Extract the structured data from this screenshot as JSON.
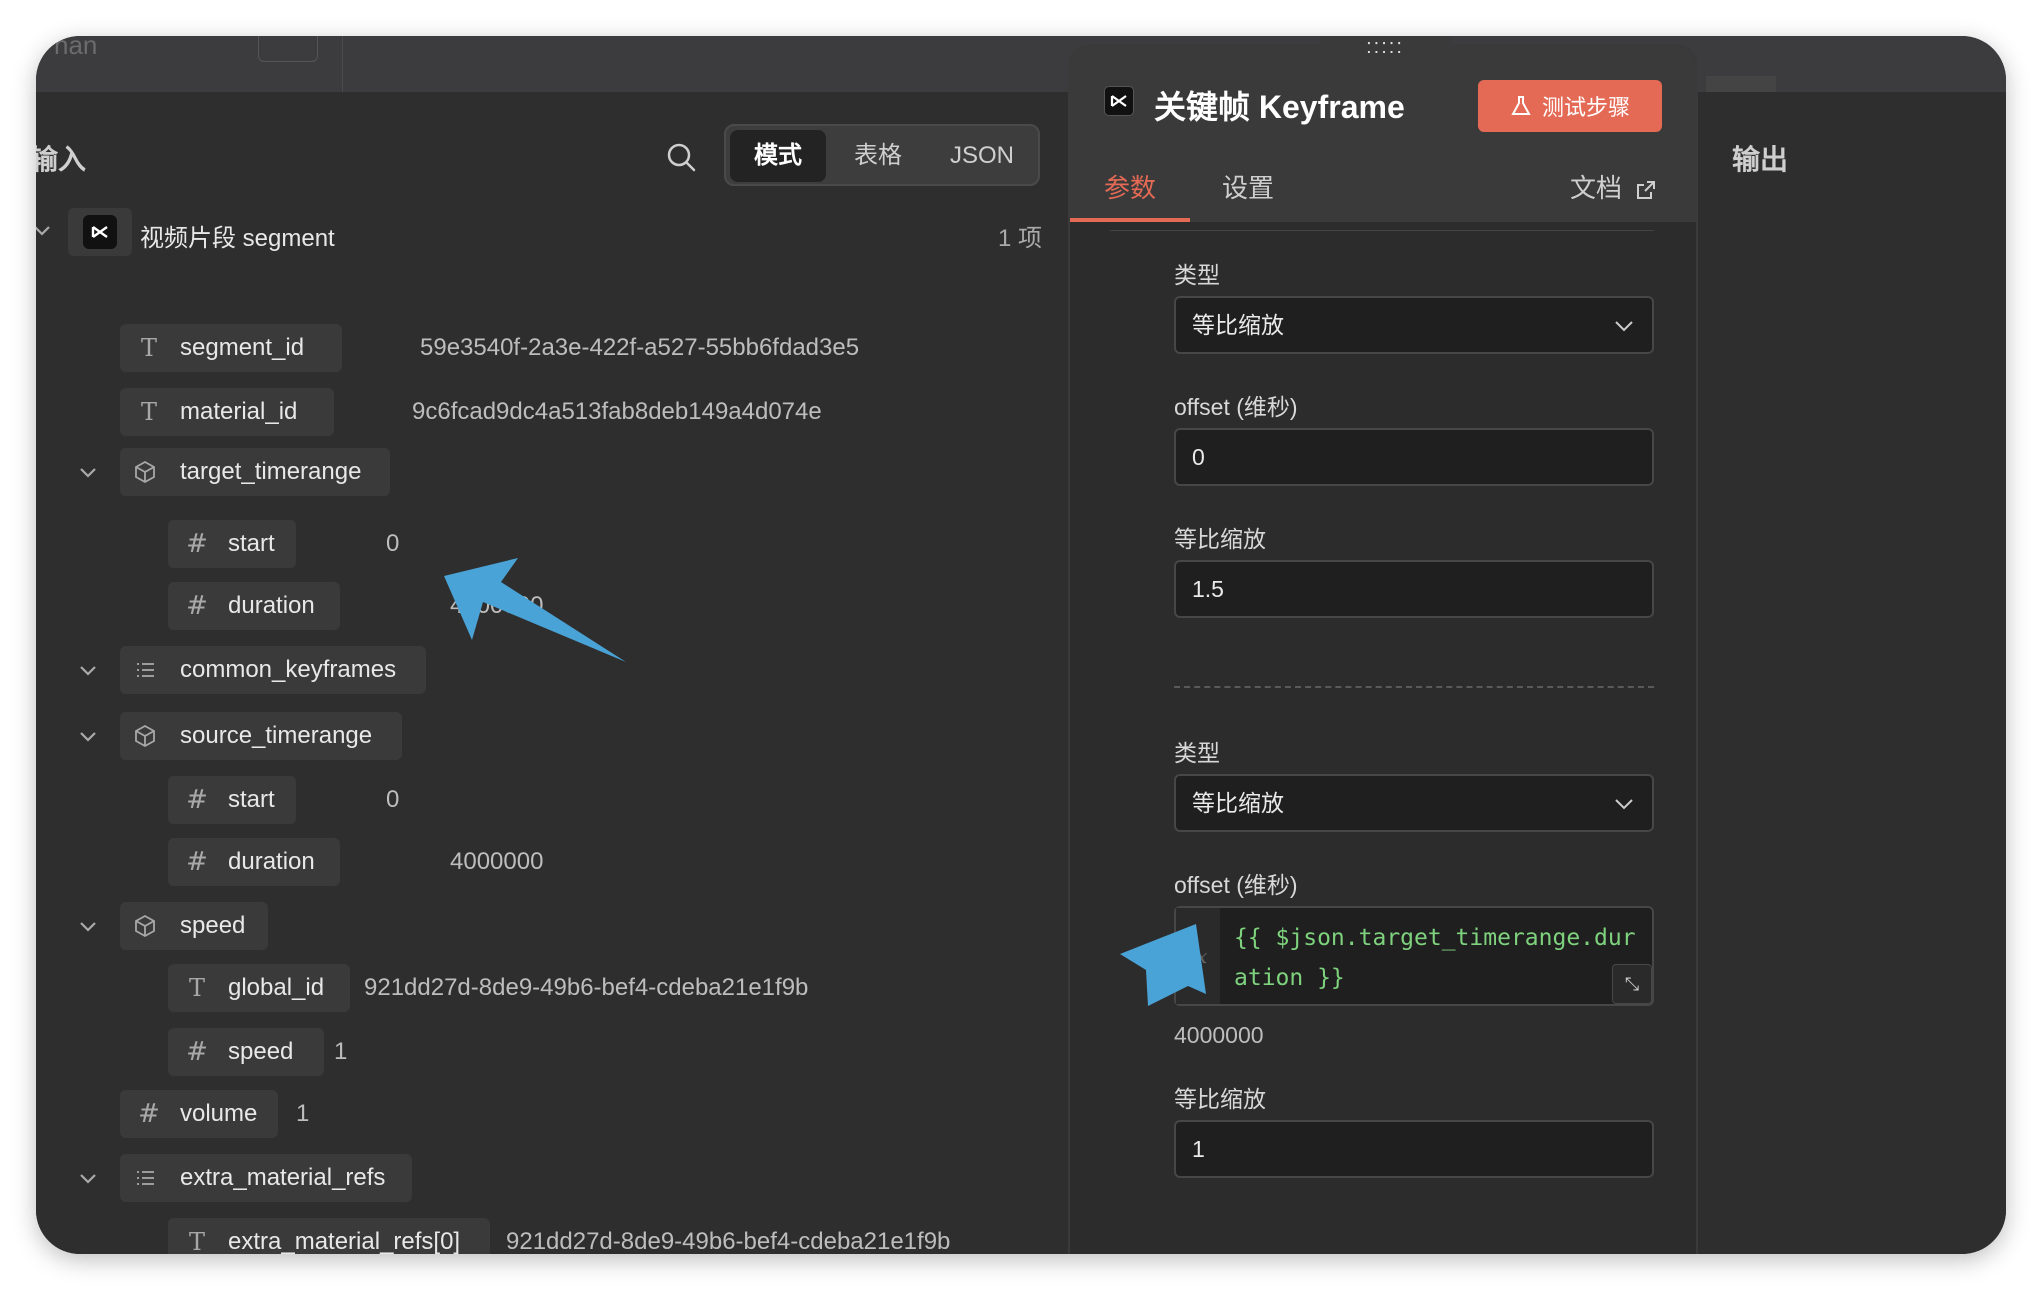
{
  "window": {
    "top_ghost_text": "nan"
  },
  "left": {
    "title": "输入",
    "view_modes": [
      "模式",
      "表格",
      "JSON"
    ],
    "active_view": "模式",
    "root": {
      "label": "视频片段 segment",
      "count": "1 项"
    },
    "rows": [
      {
        "icon": "T",
        "key": "segment_id",
        "value": "59e3540f-2a3e-422f-a527-55bb6fdad3e5"
      },
      {
        "icon": "T",
        "key": "material_id",
        "value": "9c6fcad9dc4a513fab8deb149a4d074e"
      },
      {
        "icon": "cube",
        "key": "target_timerange",
        "value": ""
      },
      {
        "icon": "#",
        "key": "start",
        "value": "0"
      },
      {
        "icon": "#",
        "key": "duration",
        "value": "4000000"
      },
      {
        "icon": "list",
        "key": "common_keyframes",
        "value": ""
      },
      {
        "icon": "cube",
        "key": "source_timerange",
        "value": ""
      },
      {
        "icon": "#",
        "key": "start",
        "value": "0"
      },
      {
        "icon": "#",
        "key": "duration",
        "value": "4000000"
      },
      {
        "icon": "cube",
        "key": "speed",
        "value": ""
      },
      {
        "icon": "T",
        "key": "global_id",
        "value": "921dd27d-8de9-49b6-bef4-cdeba21e1f9b"
      },
      {
        "icon": "#",
        "key": "speed",
        "value": "1"
      },
      {
        "icon": "#",
        "key": "volume",
        "value": "1"
      },
      {
        "icon": "list",
        "key": "extra_material_refs",
        "value": ""
      },
      {
        "icon": "T",
        "key": "extra_material_refs[0]",
        "value": "921dd27d-8de9-49b6-bef4-cdeba21e1f9b"
      }
    ]
  },
  "panel": {
    "drag_handle": ":::::",
    "title": "关键帧 Keyframe",
    "test_button": "测试步骤",
    "tabs": [
      "参数",
      "设置"
    ],
    "active_tab": "参数",
    "docs_link": "文档",
    "group1": {
      "type_label": "类型",
      "type_value": "等比缩放",
      "offset_label": "offset (维秒)",
      "offset_value": "0",
      "scale_label": "等比缩放",
      "scale_value": "1.5"
    },
    "group2": {
      "type_label": "类型",
      "type_value": "等比缩放",
      "offset_label": "offset (维秒)",
      "offset_expression": "{{ $json.target_timerange.duration }}",
      "fx_label": "fx",
      "offset_result": "4000000",
      "scale_label": "等比缩放",
      "scale_value": "1"
    }
  },
  "right": {
    "title": "输出"
  },
  "colors": {
    "accent": "#e46a55",
    "arrow": "#4aa3d6",
    "expression_text": "#7ed27e"
  }
}
